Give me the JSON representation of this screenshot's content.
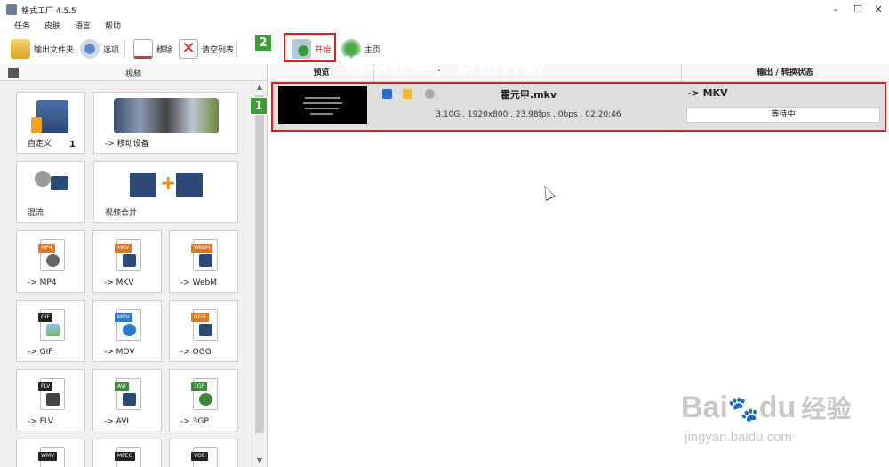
{
  "window": {
    "title": "格式工厂 4.5.5",
    "min": "–",
    "max": "☐",
    "close": "✕"
  },
  "menu": [
    "任务",
    "皮肤",
    "语言",
    "帮助"
  ],
  "toolbar": {
    "output_folder": "输出文件夹",
    "options": "选项",
    "remove": "移除",
    "clear_list": "清空列表",
    "start": "开始",
    "home": "主页"
  },
  "left_panel": {
    "header": "视频",
    "tiles": [
      {
        "label": "自定义",
        "count": "1"
      },
      {
        "label": "-> 移动设备"
      },
      {
        "label": "混流"
      },
      {
        "label": "视频合并"
      },
      {
        "label": "-> MP4",
        "tag": "MP4"
      },
      {
        "label": "-> MKV",
        "tag": "MKV"
      },
      {
        "label": "-> WebM",
        "tag": "WebM"
      },
      {
        "label": "-> GIF",
        "tag": "GIF"
      },
      {
        "label": "-> MOV",
        "tag": "MOV"
      },
      {
        "label": "-> OGG",
        "tag": "OGG"
      },
      {
        "label": "-> FLV",
        "tag": "FLV"
      },
      {
        "label": "-> AVI",
        "tag": "AVI"
      },
      {
        "label": "-> 3GP",
        "tag": "3GP"
      },
      {
        "label": "",
        "tag": "WMV"
      },
      {
        "label": "",
        "tag": "MPEG"
      },
      {
        "label": "",
        "tag": "VOB"
      }
    ]
  },
  "task_list": {
    "col_preview": "预览",
    "col_status": "输出 / 转换状态",
    "tasks": [
      {
        "file_name": "霍元甲.mkv",
        "info": "3.10G , 1920x800 , 23.98fps , 0bps , 02:20:46",
        "output": "-> MKV",
        "status": "等待中"
      }
    ]
  },
  "annotations": {
    "instruction": "选中任务，点击开始",
    "badge_1": "1",
    "badge_2": "2"
  },
  "watermark": {
    "brand": "Bai",
    "brand2": "du",
    "cn": "经验",
    "url": "jingyan.baidu.com"
  },
  "colors": {
    "accent_red": "#e01e1e",
    "badge_green": "#3aa035",
    "annotation_blue": "#1a63d2"
  }
}
